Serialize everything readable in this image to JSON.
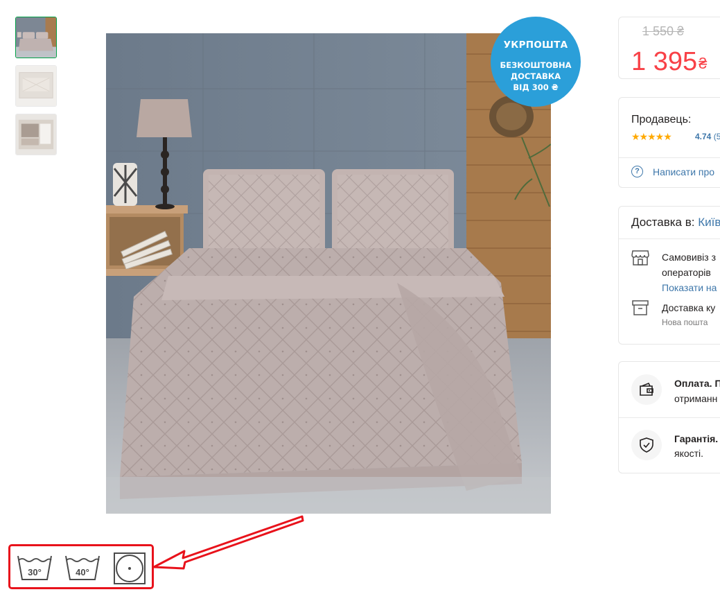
{
  "gallery": {
    "thumbnails": [
      {
        "label": "bedspread-photo",
        "active": true
      },
      {
        "label": "package-front",
        "active": false
      },
      {
        "label": "package-label",
        "active": false
      }
    ]
  },
  "promo_badge": {
    "title": "УКРПОШТА",
    "lines": [
      "БЕЗКОШТОВНА",
      "ДОСТАВКА",
      "ВІД 300 ₴"
    ],
    "color": "#2b9fd9"
  },
  "price": {
    "old": "1 550 ₴",
    "current": "1 395",
    "currency": "₴",
    "current_color": "#f84147"
  },
  "seller": {
    "label": "Продавець:",
    "stars": "★★★★★",
    "rating": "4.74",
    "rating_count": "(5",
    "write_link": "Написати про"
  },
  "delivery": {
    "label": "Доставка в:",
    "city": "Київ",
    "pickup_line1": "Самовивіз з",
    "pickup_line2": "операторів",
    "pickup_link": "Показати на",
    "courier_line": "Доставка ку",
    "courier_sub": "Нова пошта"
  },
  "payment": {
    "title": "Оплата. П",
    "text": "отриманн"
  },
  "warranty": {
    "title": "Гарантія.",
    "text": "якості."
  },
  "care_icons": {
    "wash_30": "30°",
    "wash_40": "40°",
    "tumble_dry": "tumble-dry-low-icon",
    "highlight_color": "#e8121b"
  },
  "accent_colors": {
    "link": "#3e77aa",
    "active_border": "#00a046",
    "star": "#ffa900"
  }
}
